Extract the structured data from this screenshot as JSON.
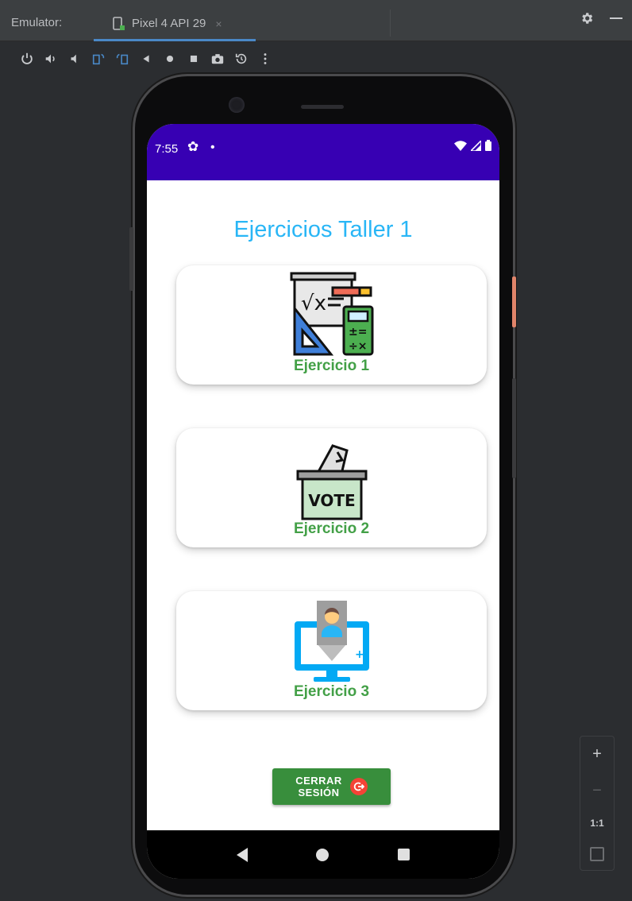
{
  "emulator": {
    "label": "Emulator:",
    "device_tab": "Pixel 4 API 29",
    "tab_close": "×",
    "toolbar_buttons": [
      "power-icon",
      "volume-up-icon",
      "volume-down-icon",
      "rotate-left-icon",
      "rotate-right-icon",
      "back-icon",
      "home-icon",
      "overview-icon",
      "screenshot-icon",
      "snapshot-icon",
      "more-icon"
    ],
    "zoom": {
      "plus": "+",
      "minus": "−",
      "actual_size": "1:1"
    }
  },
  "statusbar": {
    "time": "7:55",
    "bg_color": "#3700b3"
  },
  "app": {
    "title": "Ejercicios Taller 1",
    "title_color": "#29b6f6",
    "cards": [
      {
        "label": "Ejercicio 1",
        "icon": "math-tools-icon"
      },
      {
        "label": "Ejercicio 2",
        "icon": "ballot-box-icon",
        "icon_text": "VOTE"
      },
      {
        "label": "Ejercicio 3",
        "icon": "computer-user-icon"
      }
    ],
    "label_color": "#43a047",
    "logout": {
      "line1": "CERRAR",
      "line2": "SESIÓN",
      "bg_color": "#388e3c",
      "icon": "logout-icon"
    }
  }
}
